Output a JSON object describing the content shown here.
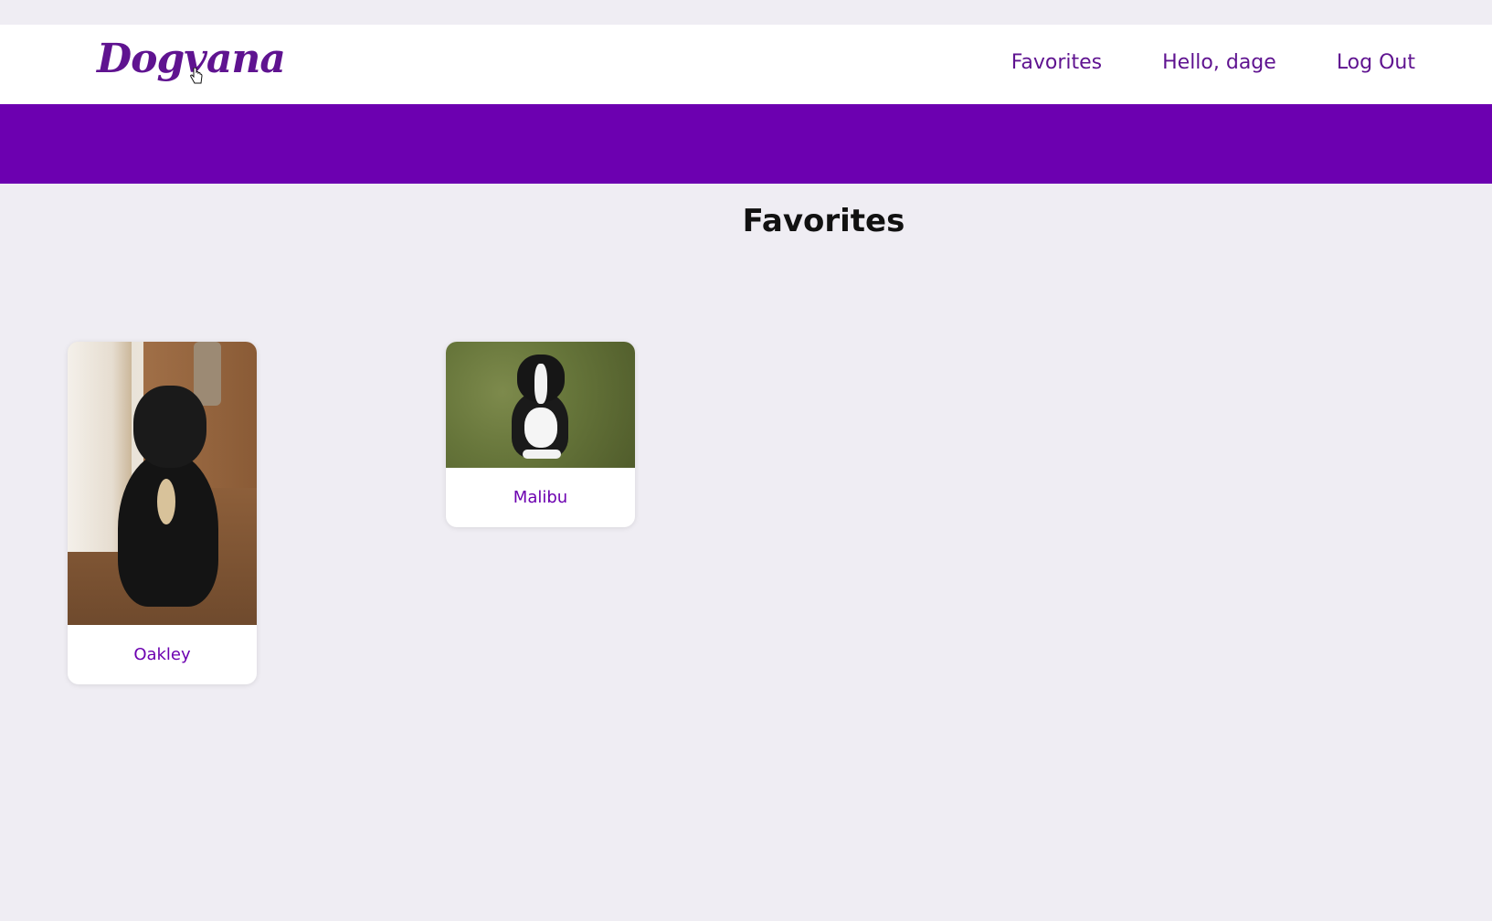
{
  "navbar": {
    "logo": "Dogvana",
    "links": [
      {
        "label": "Favorites"
      },
      {
        "label": "Hello, dage"
      },
      {
        "label": "Log Out"
      }
    ]
  },
  "main": {
    "title": "Favorites",
    "cards": [
      {
        "name": "Oakley"
      },
      {
        "name": "Malibu"
      }
    ]
  },
  "colors": {
    "brand_purple": "#6c00b0",
    "nav_text": "#5f1390",
    "page_bg": "#efedf3"
  }
}
